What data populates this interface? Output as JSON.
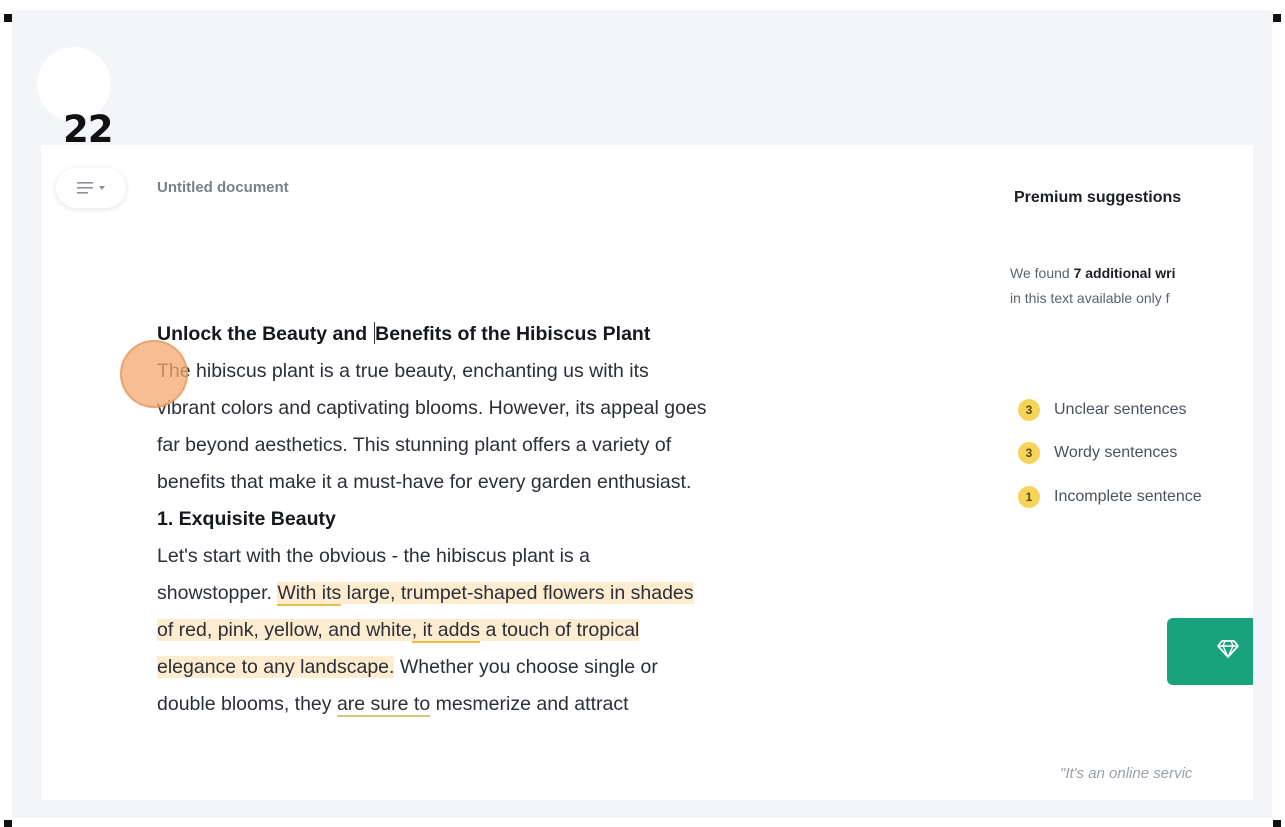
{
  "tutorial": {
    "step_number": "22"
  },
  "header": {
    "menu_icon": "menu-lines-icon",
    "document_title": "Untitled document"
  },
  "editor": {
    "heading_before_caret": "Unlock the Beauty and ",
    "heading_after_caret": "Benefits of the Hibiscus Plant",
    "p1_l1": "The hibiscus plant is a true beauty, enchanting us with its",
    "p1_l2": "vibrant colors and captivating blooms. However, its appeal goes",
    "p1_l3": "far beyond aesthetics. This stunning plant offers a variety of",
    "p1_l4": "benefits that make it a must-have for every garden enthusiast.",
    "subheading": "1. Exquisite Beauty",
    "p2_l1": "Let's start with the obvious - the hibiscus plant is a",
    "p2_l2_a": "showstopper. ",
    "p2_l2_b": "With its",
    "p2_l2_c": " large, trumpet-shaped flowers in shades",
    "p2_l3_a": "of red, pink, yellow, and white",
    "p2_l3_b": ", it adds",
    "p2_l3_c": " a touch of tropical",
    "p2_l4_a": "elegance to any landscape.",
    "p2_l4_b": " Whether you choose single or",
    "p2_l5_a": "double blooms, they ",
    "p2_l5_b": "are sure to",
    "p2_l5_c": " mesmerize and attract",
    "highlight_color": "#fdecd0",
    "underline_color": "#e6c04a"
  },
  "sidebar": {
    "title": "Premium suggestions",
    "found_prefix": "We found ",
    "found_bold": "7 additional wri",
    "found_line2": "in this text available only f",
    "issues": [
      {
        "count": "3",
        "label": "Unclear sentences"
      },
      {
        "count": "3",
        "label": "Wordy sentences"
      },
      {
        "count": "1",
        "label": "Incomplete sentence"
      }
    ],
    "button_icon": "diamond-icon",
    "button_color": "#18a37d",
    "quote": "\"It's an online servic"
  },
  "colors": {
    "backdrop": "#f3f5f9",
    "click_marker": "#f4a86e",
    "badge": "#f6d45a"
  }
}
